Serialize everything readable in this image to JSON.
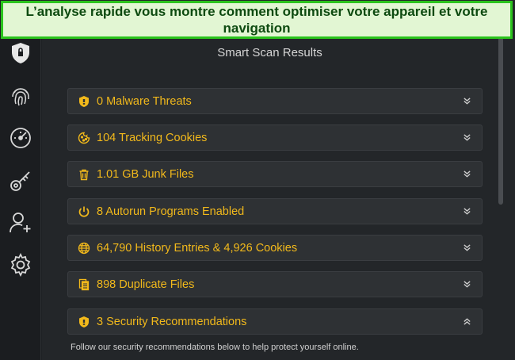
{
  "banner": {
    "text": "L’analyse rapide vous montre comment optimiser votre appareil et votre navigation"
  },
  "sidebar": {
    "items": [
      {
        "icon": "shield-icon"
      },
      {
        "icon": "fingerprint-icon"
      },
      {
        "icon": "speedometer-icon"
      },
      {
        "icon": "key-icon"
      },
      {
        "icon": "add-user-icon"
      },
      {
        "icon": "gear-icon"
      }
    ]
  },
  "main": {
    "title": "Smart Scan Results",
    "results": [
      {
        "label": "0 Malware Threats",
        "icon": "shield-icon",
        "expanded": false
      },
      {
        "label": "104 Tracking Cookies",
        "icon": "cookie-icon",
        "expanded": false
      },
      {
        "label": "1.01 GB Junk Files",
        "icon": "trash-icon",
        "expanded": false
      },
      {
        "label": "8 Autorun Programs Enabled",
        "icon": "power-icon",
        "expanded": false
      },
      {
        "label": "64,790 History Entries & 4,926 Cookies",
        "icon": "globe-icon",
        "expanded": false
      },
      {
        "label": "898 Duplicate Files",
        "icon": "duplicate-files-icon",
        "expanded": false
      },
      {
        "label": "3 Security Recommendations",
        "icon": "shield-icon",
        "expanded": true
      }
    ],
    "helper_text": "Follow our security recommendations below to help protect yourself online."
  },
  "colors": {
    "accent": "#f2b91b",
    "banner_border": "#2bc31d",
    "banner_bg": "#e2f6d3"
  }
}
